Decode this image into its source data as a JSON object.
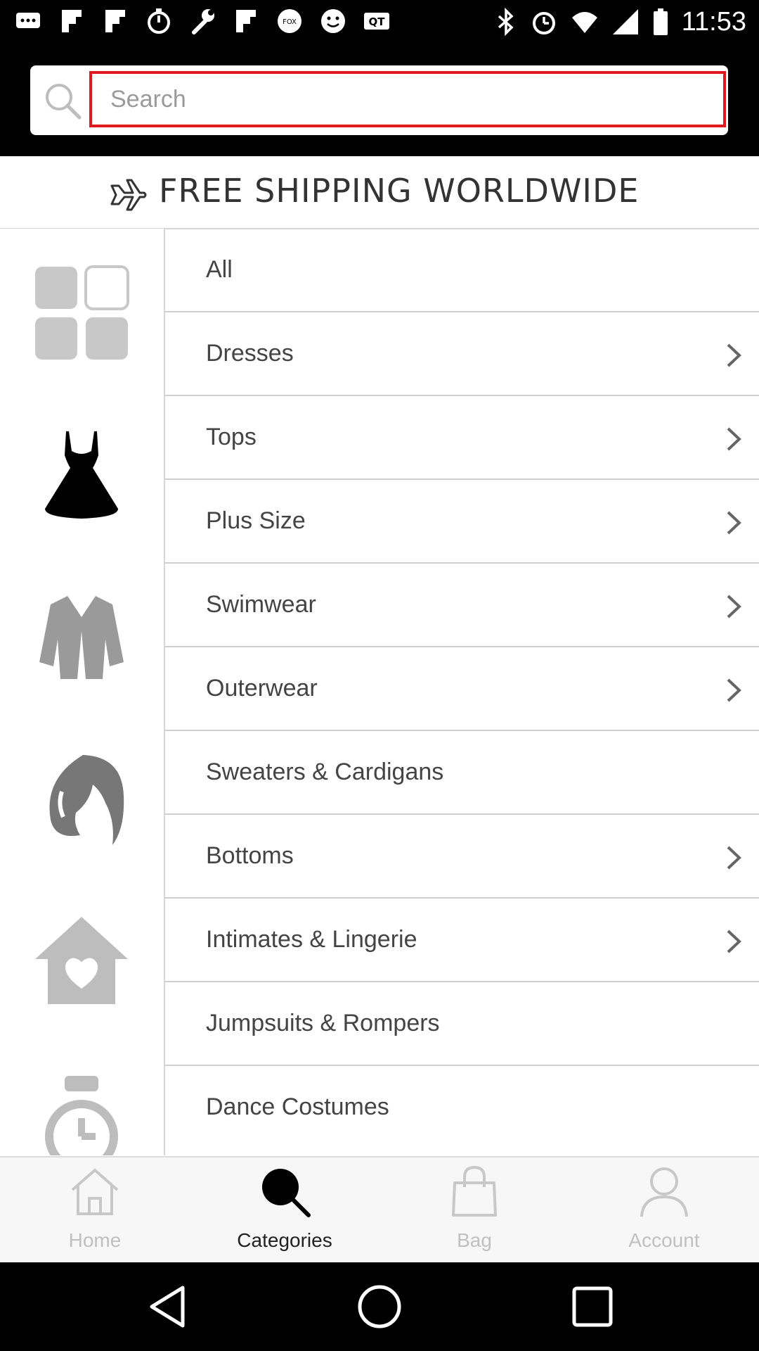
{
  "status_bar": {
    "time": "11:53"
  },
  "search": {
    "placeholder": "Search"
  },
  "banner": {
    "text": "FREE SHIPPING WORLDWIDE"
  },
  "categories": [
    {
      "label": "All",
      "has_arrow": false
    },
    {
      "label": "Dresses",
      "has_arrow": true
    },
    {
      "label": "Tops",
      "has_arrow": true
    },
    {
      "label": "Plus Size",
      "has_arrow": true
    },
    {
      "label": "Swimwear",
      "has_arrow": true
    },
    {
      "label": "Outerwear",
      "has_arrow": true
    },
    {
      "label": "Sweaters & Cardigans",
      "has_arrow": false
    },
    {
      "label": "Bottoms",
      "has_arrow": true
    },
    {
      "label": "Intimates & Lingerie",
      "has_arrow": true
    },
    {
      "label": "Jumpsuits & Rompers",
      "has_arrow": false
    },
    {
      "label": "Dance Costumes",
      "has_arrow": false
    }
  ],
  "left_icons": [
    "grid-icon",
    "dress-icon",
    "jacket-icon",
    "hair-icon",
    "home-heart-icon",
    "watch-icon"
  ],
  "bottom_nav": {
    "home": "Home",
    "categories": "Categories",
    "bag": "Bag",
    "account": "Account",
    "active": "categories"
  },
  "colors": {
    "search_border": "#e0191f",
    "header_bg": "#000000"
  }
}
